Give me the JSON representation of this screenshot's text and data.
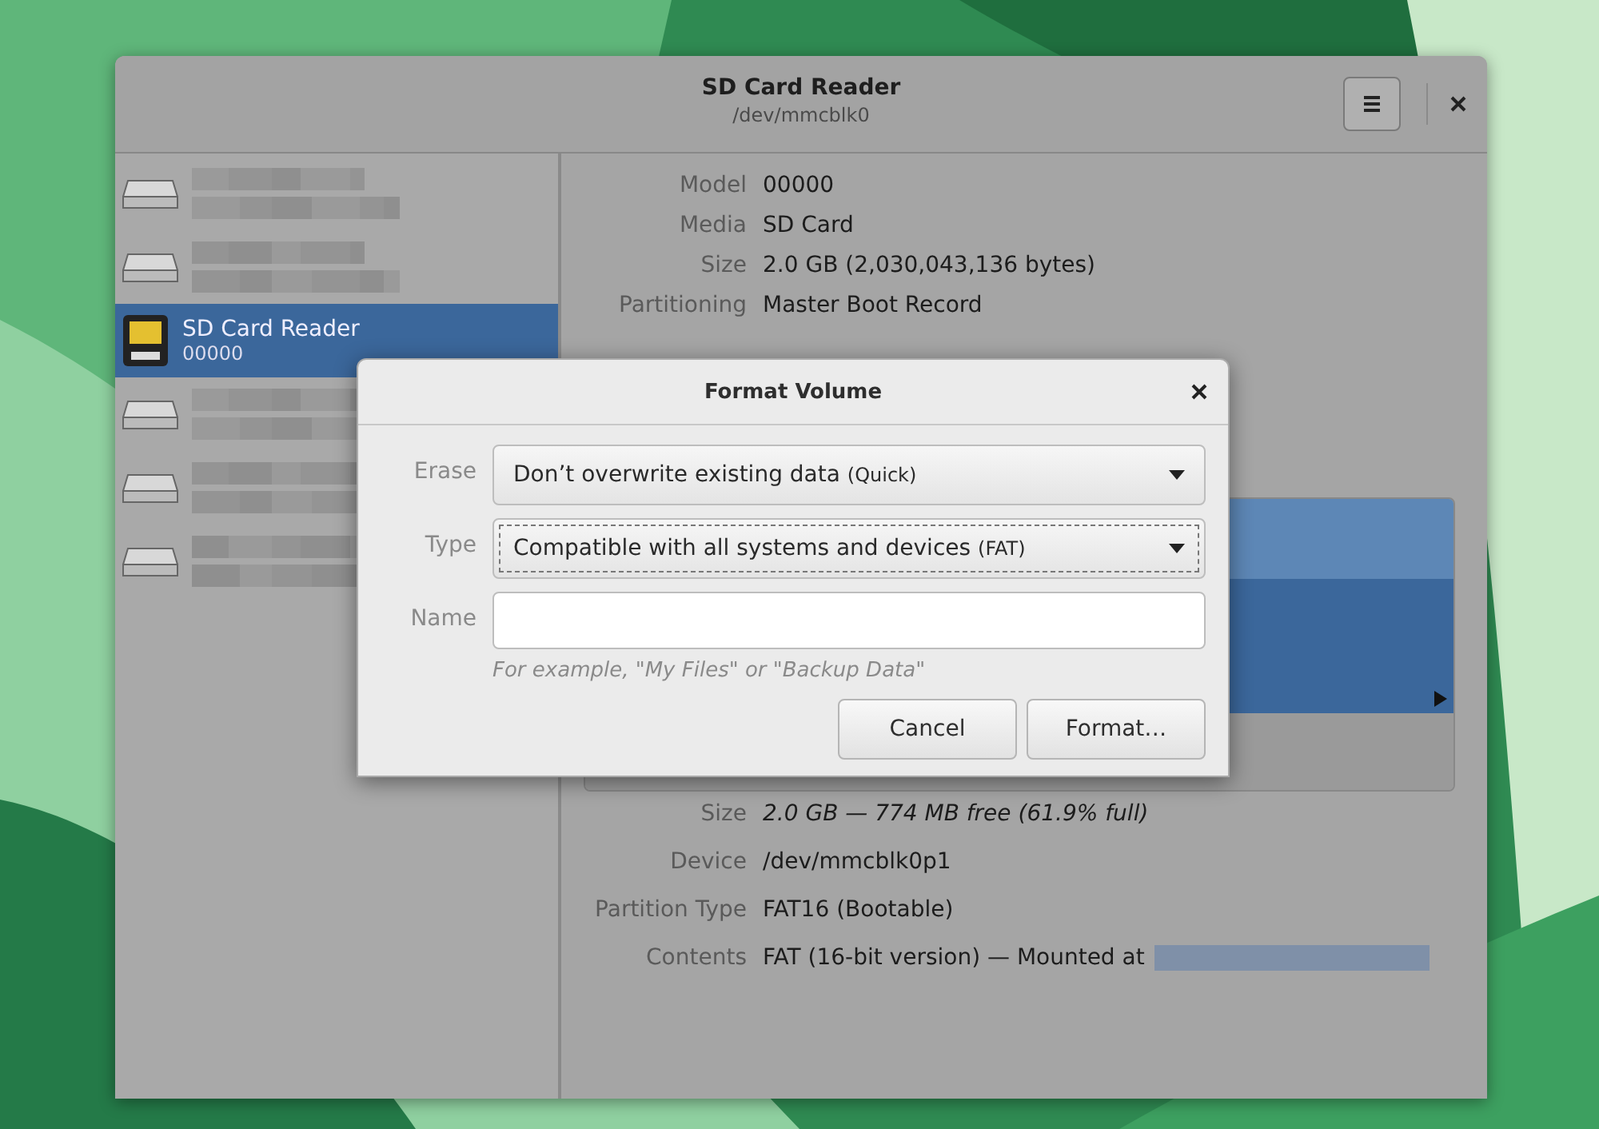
{
  "window": {
    "title": "SD Card Reader",
    "subtitle": "/dev/mmcblk0"
  },
  "sidebar": {
    "items": [
      {
        "kind": "drive",
        "selected": false
      },
      {
        "kind": "drive",
        "selected": false
      },
      {
        "kind": "sd-card",
        "selected": true,
        "title": "SD Card Reader",
        "subtitle": "00000"
      },
      {
        "kind": "drive",
        "selected": false
      },
      {
        "kind": "drive",
        "selected": false
      },
      {
        "kind": "drive",
        "selected": false
      }
    ]
  },
  "drive_details": [
    {
      "label": "Model",
      "value": "00000"
    },
    {
      "label": "Media",
      "value": "SD Card"
    },
    {
      "label": "Size",
      "value": "2.0 GB (2,030,043,136 bytes)"
    },
    {
      "label": "Partitioning",
      "value": "Master Boot Record"
    }
  ],
  "volume_details": [
    {
      "label": "Size",
      "value": "2.0 GB — 774 MB free (61.9% full)",
      "italic": true
    },
    {
      "label": "Device",
      "value": "/dev/mmcblk0p1",
      "italic": false
    },
    {
      "label": "Partition Type",
      "value": "FAT16 (Bootable)",
      "italic": false
    },
    {
      "label": "Contents",
      "value": "FAT (16-bit version) — Mounted at",
      "italic": false,
      "blurred_link": true
    }
  ],
  "dialog": {
    "title": "Format Volume",
    "fields": [
      {
        "kind": "dropdown",
        "label": "Erase",
        "value": "Don’t overwrite existing data",
        "hint": "(Quick)",
        "focused": false
      },
      {
        "kind": "dropdown",
        "label": "Type",
        "value": "Compatible with all systems and devices",
        "hint": "(FAT)",
        "focused": true
      },
      {
        "kind": "text",
        "label": "Name",
        "helper": "For example, \"My Files\" or \"Backup Data\""
      }
    ],
    "buttons": [
      "Cancel",
      "Format…"
    ]
  }
}
